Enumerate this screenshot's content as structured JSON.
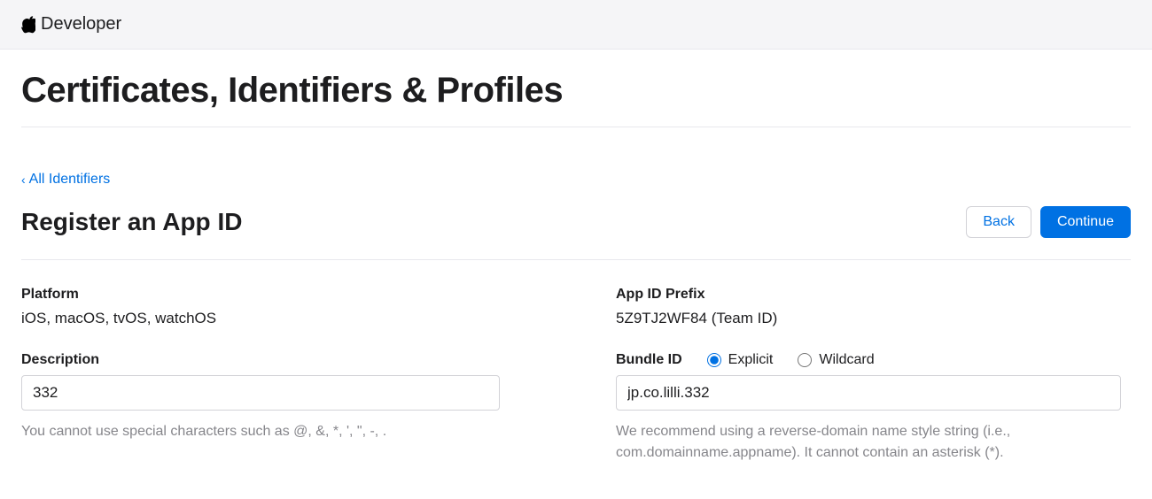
{
  "topbar": {
    "brand": "Developer"
  },
  "page": {
    "main_title": "Certificates, Identifiers & Profiles",
    "back_link": "All Identifiers",
    "sub_title": "Register an App ID",
    "back_button": "Back",
    "continue_button": "Continue"
  },
  "form": {
    "platform": {
      "label": "Platform",
      "value": "iOS, macOS, tvOS, watchOS"
    },
    "description": {
      "label": "Description",
      "value": "332",
      "help": "You cannot use special characters such as @, &, *, ', \", -, ."
    },
    "app_id_prefix": {
      "label": "App ID Prefix",
      "value": "5Z9TJ2WF84 (Team ID)"
    },
    "bundle_id": {
      "label": "Bundle ID",
      "explicit_label": "Explicit",
      "wildcard_label": "Wildcard",
      "selected": "explicit",
      "value": "jp.co.lilli.332",
      "help": "We recommend using a reverse-domain name style string (i.e., com.domainname.appname). It cannot contain an asterisk (*)."
    }
  }
}
